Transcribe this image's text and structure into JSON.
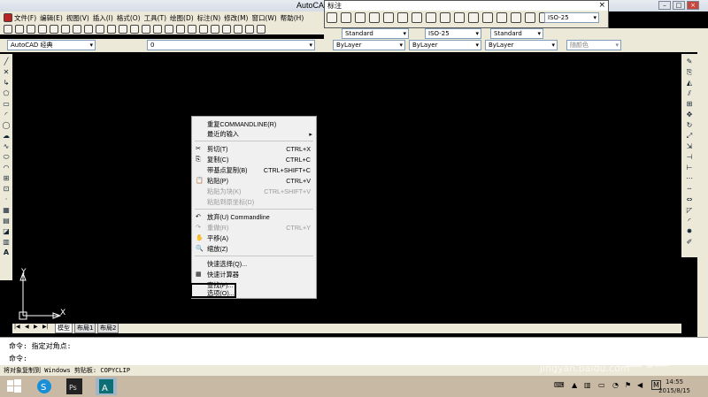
{
  "window": {
    "title": "AutoCAD 200"
  },
  "menubar": {
    "items": [
      "文件(F)",
      "编辑(E)",
      "视图(V)",
      "插入(I)",
      "格式(O)",
      "工具(T)",
      "绘图(D)",
      "标注(N)",
      "修改(M)",
      "窗口(W)",
      "帮助(H)"
    ]
  },
  "dim_toolbar": {
    "title": "标注",
    "close": "×",
    "style_value": "ISO-25"
  },
  "toolbar2": {
    "std1": "Standard",
    "std2": "ISO-25",
    "std3": "Standard"
  },
  "toolbar3": {
    "workspace": "AutoCAD 经典",
    "layer": "0",
    "color": "ByLayer",
    "linetype": "ByLayer",
    "lineweight": "ByLayer",
    "plotstyle": "随颜色"
  },
  "context_menu": {
    "items": [
      {
        "label": "重复COMMANDLINE(R)",
        "shortcut": "",
        "disabled": false
      },
      {
        "label": "最近的输入",
        "shortcut": "",
        "disabled": false,
        "submenu": true
      },
      {
        "label": "剪切(T)",
        "shortcut": "CTRL+X",
        "disabled": false
      },
      {
        "label": "复制(C)",
        "shortcut": "CTRL+C",
        "disabled": false
      },
      {
        "label": "带基点复制(B)",
        "shortcut": "CTRL+SHIFT+C",
        "disabled": false
      },
      {
        "label": "粘贴(P)",
        "shortcut": "CTRL+V",
        "disabled": false
      },
      {
        "label": "粘贴为块(K)",
        "shortcut": "CTRL+SHIFT+V",
        "disabled": true
      },
      {
        "label": "粘贴到原坐标(D)",
        "shortcut": "",
        "disabled": true
      },
      {
        "label": "放弃(U) Commandline",
        "shortcut": "",
        "disabled": false
      },
      {
        "label": "重做(R)",
        "shortcut": "CTRL+Y",
        "disabled": true
      },
      {
        "label": "平移(A)",
        "shortcut": "",
        "disabled": false
      },
      {
        "label": "缩放(Z)",
        "shortcut": "",
        "disabled": false
      },
      {
        "label": "快速选择(Q)...",
        "shortcut": "",
        "disabled": false
      },
      {
        "label": "快速计算器",
        "shortcut": "",
        "disabled": false
      },
      {
        "label": "查找(F)...",
        "shortcut": "",
        "disabled": false
      },
      {
        "label": "选项(O)...",
        "shortcut": "",
        "disabled": false
      }
    ]
  },
  "ucs": {
    "x": "X",
    "y": "Y"
  },
  "tabs": {
    "nav": [
      "|◀",
      "◀",
      "▶",
      "▶|"
    ],
    "items": [
      "模型",
      "布局1",
      "布局2"
    ]
  },
  "command": {
    "line1": "命令: 指定对角点:",
    "line2": "命令:"
  },
  "status": {
    "text": "将对象复制到 Windows 剪贴板:   COPYCLIP"
  },
  "taskbar": {
    "time": "14:55",
    "date": "2015/8/15",
    "ime": "M"
  },
  "watermark": {
    "text": "Baidu 经验",
    "url": "jingyan.baidu.com"
  },
  "colors": {
    "canvas": "#000000",
    "chrome": "#ece9d8",
    "menu_bg": "#f0f0f0",
    "highlight_border": "#000000"
  }
}
